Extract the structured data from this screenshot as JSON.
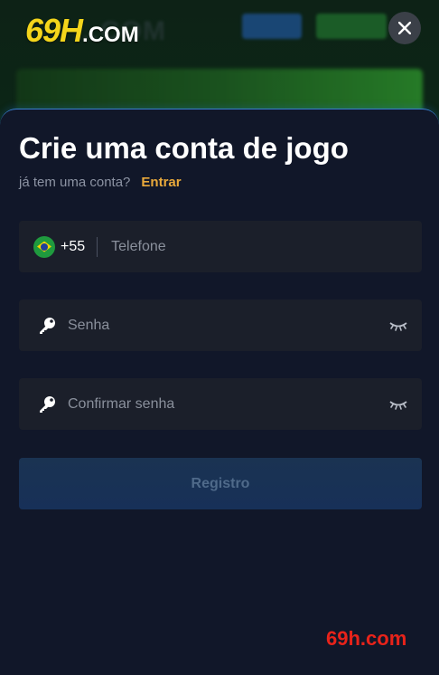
{
  "header": {
    "logo_text": "69H",
    "logo_sub": ".COM",
    "close_icon": "close-icon"
  },
  "modal": {
    "title": "Crie uma conta de jogo",
    "have_account": "já tem uma conta?",
    "login_link": "Entrar",
    "phone": {
      "country_code": "+55",
      "placeholder": "Telefone",
      "flag_icon": "brazil-flag-icon",
      "value": ""
    },
    "password": {
      "placeholder": "Senha",
      "value": "",
      "icon": "key-icon",
      "toggle_icon": "eye-closed-icon"
    },
    "confirm_password": {
      "placeholder": "Confirmar senha",
      "value": "",
      "icon": "key-icon",
      "toggle_icon": "eye-closed-icon"
    },
    "submit_label": "Registro"
  },
  "watermark": "69h.com",
  "colors": {
    "accent_link": "#e9a93b",
    "modal_bg": "#111729",
    "field_bg": "#1b1f2a",
    "logo_yellow": "#f4d51b",
    "watermark_red": "#e8231a"
  }
}
